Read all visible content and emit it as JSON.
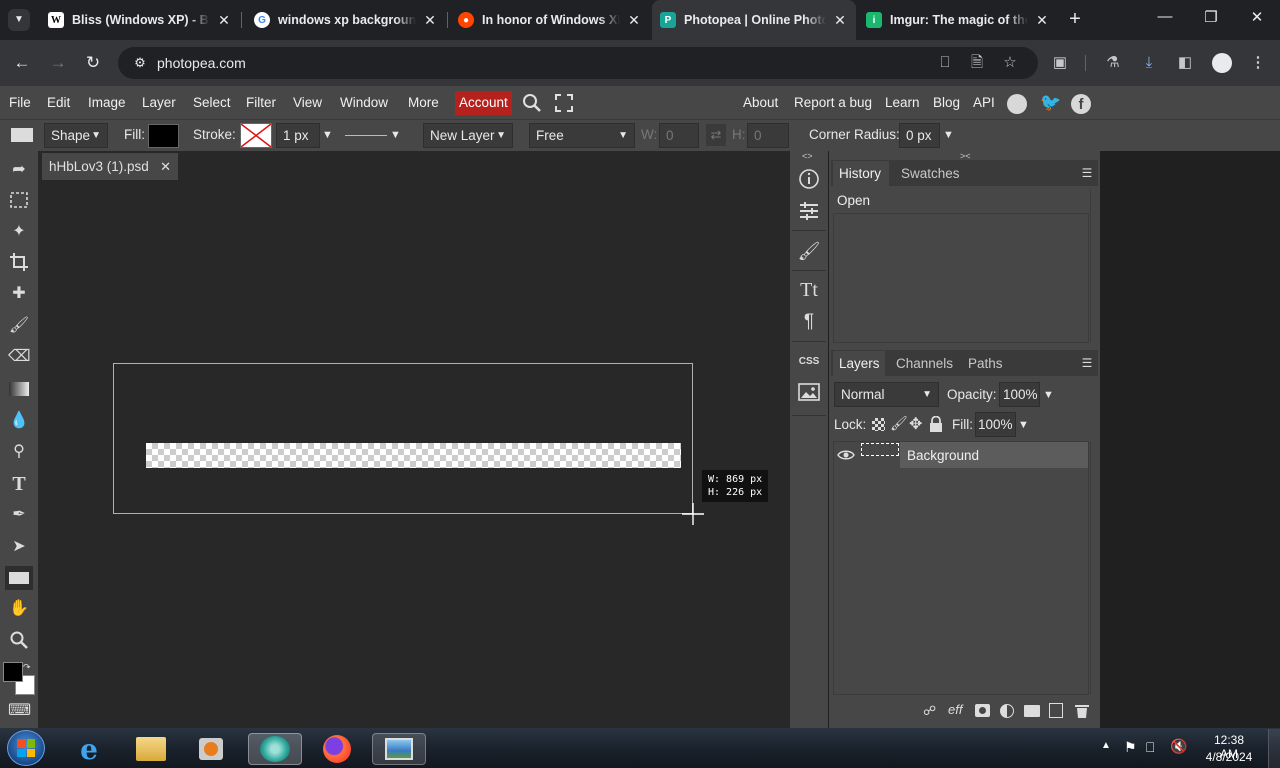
{
  "browser": {
    "tabs": [
      {
        "title": "Bliss (Windows XP) - Bliss",
        "favicon": "W",
        "active": false
      },
      {
        "title": "windows xp background",
        "favicon": "G",
        "active": false
      },
      {
        "title": "In honor of Windows XP",
        "favicon": "reddit",
        "active": false
      },
      {
        "title": "Photopea | Online Photo Editor",
        "favicon": "P",
        "active": true
      },
      {
        "title": "Imgur: The magic of the Internet",
        "favicon": "imgur",
        "active": false
      }
    ],
    "new_tab": "+",
    "url": "photopea.com"
  },
  "menubar": {
    "items": [
      "File",
      "Edit",
      "Image",
      "Layer",
      "Select",
      "Filter",
      "View",
      "Window",
      "More"
    ],
    "account": "Account",
    "right_items": [
      "About",
      "Report a bug",
      "Learn",
      "Blog",
      "API"
    ]
  },
  "options": {
    "shape_mode": "Shape",
    "fill_label": "Fill:",
    "stroke_label": "Stroke:",
    "stroke_width": "1 px",
    "layer_mode": "New Layer",
    "constraint": "Free",
    "w_label": "W:",
    "w_value": "0",
    "h_label": "H:",
    "h_value": "0",
    "corner_label": "Corner Radius:",
    "corner_value": "0 px"
  },
  "document": {
    "tab_name": "hHbLov3 (1).psd",
    "tooltip_w": "W: 869 px",
    "tooltip_h": "H: 226 px"
  },
  "history_panel": {
    "tabs": [
      "History",
      "Swatches"
    ],
    "items": [
      "Open"
    ]
  },
  "layers_panel": {
    "tabs": [
      "Layers",
      "Channels",
      "Paths"
    ],
    "blend_mode": "Normal",
    "opacity_label": "Opacity:",
    "opacity_value": "100%",
    "lock_label": "Lock:",
    "fill_label": "Fill:",
    "fill_value": "100%",
    "layers": [
      {
        "name": "Background"
      }
    ]
  },
  "midbar": {
    "css_label": "CSS"
  },
  "taskbar": {
    "time": "12:38 AM",
    "date": "4/8/2024"
  },
  "colors": {
    "account_red": "#b5211d",
    "panel_gray": "#474747",
    "canvas_bg": "#282828"
  }
}
